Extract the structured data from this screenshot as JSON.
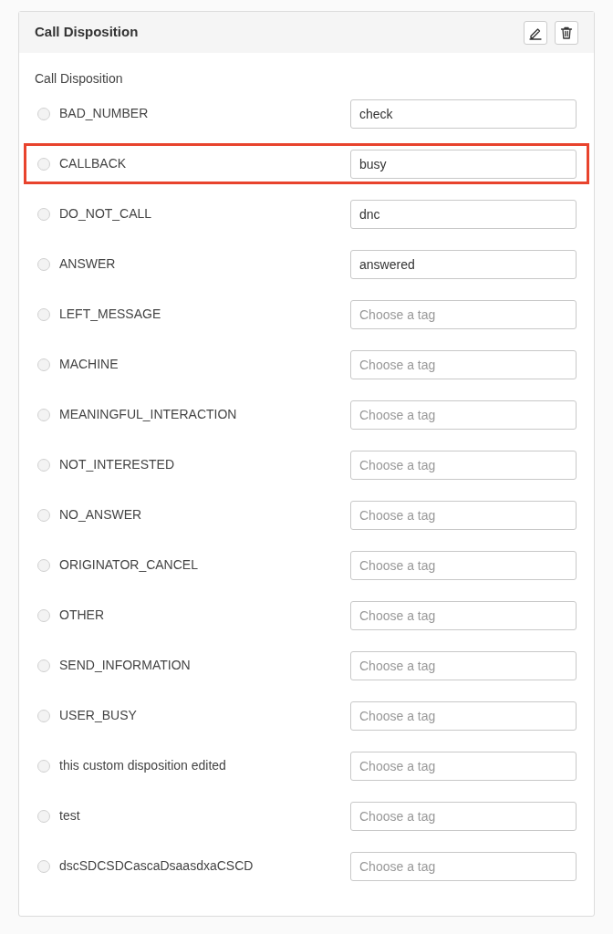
{
  "card": {
    "title": "Call Disposition",
    "actions": [
      {
        "kind": "edit"
      },
      {
        "kind": "delete"
      }
    ]
  },
  "section_label": "Call Disposition",
  "rows": [
    {
      "name": "BAD_NUMBER",
      "selected": false,
      "highlighted": false,
      "value": "check"
    },
    {
      "name": "CALLBACK",
      "selected": false,
      "highlighted": true,
      "value": "busy"
    },
    {
      "name": "DO_NOT_CALL",
      "selected": false,
      "highlighted": false,
      "value": "dnc"
    },
    {
      "name": "ANSWER",
      "selected": false,
      "highlighted": false,
      "value": "answered"
    },
    {
      "name": "LEFT_MESSAGE",
      "selected": false,
      "highlighted": false,
      "placeholder": "Choose a tag"
    },
    {
      "name": "MACHINE",
      "selected": false,
      "highlighted": false,
      "placeholder": "Choose a tag"
    },
    {
      "name": "MEANINGFUL_INTERACTION",
      "selected": false,
      "highlighted": false,
      "placeholder": "Choose a tag"
    },
    {
      "name": "NOT_INTERESTED",
      "selected": false,
      "highlighted": false,
      "placeholder": "Choose a tag"
    },
    {
      "name": "NO_ANSWER",
      "selected": false,
      "highlighted": false,
      "placeholder": "Choose a tag"
    },
    {
      "name": "ORIGINATOR_CANCEL",
      "selected": false,
      "highlighted": false,
      "placeholder": "Choose a tag"
    },
    {
      "name": "OTHER",
      "selected": false,
      "highlighted": false,
      "placeholder": "Choose a tag"
    },
    {
      "name": "SEND_INFORMATION",
      "selected": false,
      "highlighted": false,
      "placeholder": "Choose a tag"
    },
    {
      "name": "USER_BUSY",
      "selected": false,
      "highlighted": false,
      "placeholder": "Choose a tag"
    },
    {
      "name": "this custom disposition edited",
      "selected": false,
      "highlighted": false,
      "placeholder": "Choose a tag"
    },
    {
      "name": "test",
      "selected": false,
      "highlighted": false,
      "placeholder": "Choose a tag"
    },
    {
      "name": "dscSDCSDCascaDsaasdxaCSCD",
      "selected": false,
      "highlighted": false,
      "placeholder": "Choose a tag"
    }
  ]
}
